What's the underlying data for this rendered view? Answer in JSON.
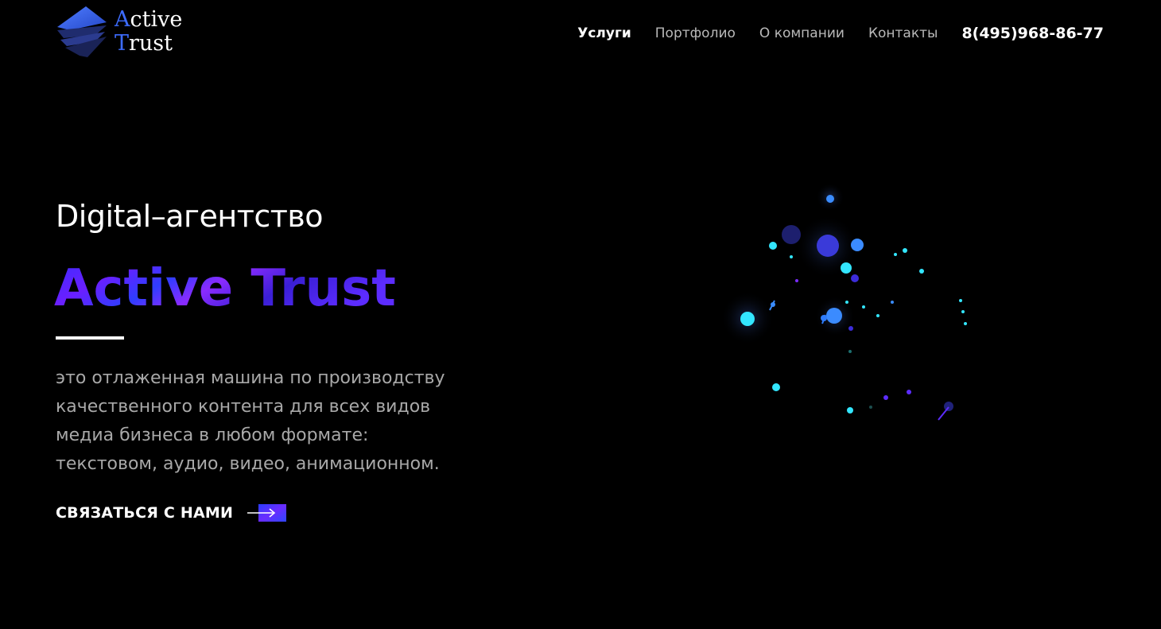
{
  "header": {
    "logo": {
      "line1_initial": "A",
      "line1_rest": "ctive",
      "line2_initial": "T",
      "line2_rest": "rust"
    },
    "nav": [
      {
        "label": "Услуги",
        "active": true
      },
      {
        "label": "Портфолио",
        "active": false
      },
      {
        "label": "О компании",
        "active": false
      },
      {
        "label": "Контакты",
        "active": false
      }
    ],
    "phone": "8(495)968-86-77"
  },
  "hero": {
    "kicker": "Digital–агентство",
    "brand": "Active Trust",
    "description_lines": [
      "это отлаженная машина по производству",
      "качественного контента для всех видов",
      "медиа бизнеса в любом формате:",
      "текстовом, аудио, видео, анимационном."
    ],
    "cta_label": "СВЯЗАТЬСЯ С НАМИ",
    "cta_icon": "arrow-right-icon"
  },
  "colors": {
    "background": "#000000",
    "accent_blue": "#3d6cff",
    "accent_purple": "#7a2cff",
    "accent_cyan": "#33e6ff",
    "nav_inactive": "#b9b9b9",
    "body_text": "#a8a8a8"
  }
}
